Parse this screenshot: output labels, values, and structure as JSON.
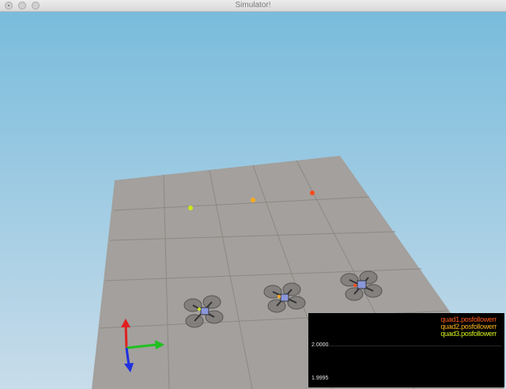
{
  "window": {
    "title": "Simulator!"
  },
  "graph": {
    "legend": [
      {
        "label": "quad1.posfollowerr",
        "color": "#ff5a1a"
      },
      {
        "label": "quad2.posfollowerr",
        "color": "#ffb31a"
      },
      {
        "label": "quad3.posfollowerr",
        "color": "#d7f21a"
      }
    ],
    "ticks": [
      "2.0000",
      "1.9995"
    ]
  },
  "colors": {
    "sky_top": "#79bcdc",
    "sky_bottom": "#c8dcea",
    "floor": "#a3a09d",
    "grid": "#8c8985"
  }
}
